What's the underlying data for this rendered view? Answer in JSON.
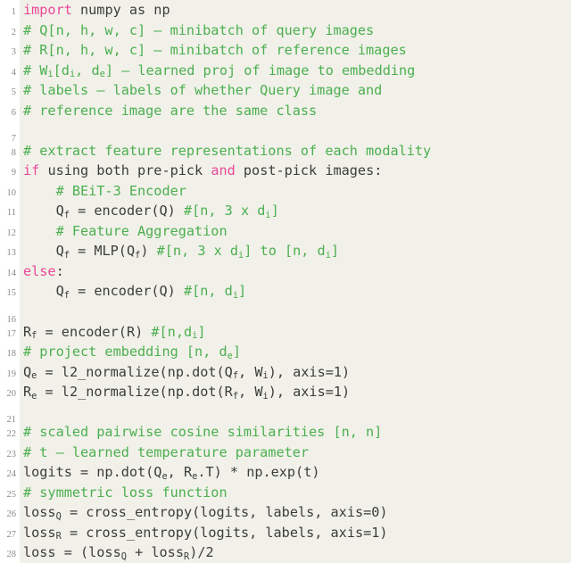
{
  "listing": {
    "language": "python",
    "colors": {
      "background": "#ffffff",
      "code_background": "#f1f1e9",
      "gutter_text": "#8a8a86",
      "keyword": "#ec4899",
      "comment": "#4caf50",
      "text": "#3c3c3c"
    },
    "line_count": 28,
    "lines": [
      {
        "n": "1",
        "tokens": [
          {
            "t": "kw",
            "s": "import"
          },
          {
            "t": "tx",
            "s": " numpy as np"
          }
        ]
      },
      {
        "n": "2",
        "tokens": [
          {
            "t": "cm",
            "s": "# Q[n, h, w, c] – minibatch of query images"
          }
        ]
      },
      {
        "n": "3",
        "tokens": [
          {
            "t": "cm",
            "s": "# R[n, h, w, c] – minibatch of reference images"
          }
        ]
      },
      {
        "n": "4",
        "tokens": [
          {
            "t": "cm",
            "s": "# W"
          },
          {
            "t": "cm-sub",
            "s": "i"
          },
          {
            "t": "cm",
            "s": "[d"
          },
          {
            "t": "cm-sub",
            "s": "i"
          },
          {
            "t": "cm",
            "s": ", d"
          },
          {
            "t": "cm-sub",
            "s": "e"
          },
          {
            "t": "cm",
            "s": "] – learned proj of image to embedding"
          }
        ]
      },
      {
        "n": "5",
        "tokens": [
          {
            "t": "cm",
            "s": "# labels – labels of whether Query image and"
          }
        ]
      },
      {
        "n": "6",
        "tokens": [
          {
            "t": "cm",
            "s": "# reference image are the same class"
          }
        ]
      },
      {
        "n": "7",
        "tokens": []
      },
      {
        "n": "8",
        "tokens": [
          {
            "t": "cm",
            "s": "# extract feature representations of each modality"
          }
        ]
      },
      {
        "n": "9",
        "tokens": [
          {
            "t": "kw",
            "s": "if"
          },
          {
            "t": "tx",
            "s": " using both pre-pick "
          },
          {
            "t": "kw",
            "s": "and"
          },
          {
            "t": "tx",
            "s": " post-pick images:"
          }
        ]
      },
      {
        "n": "10",
        "tokens": [
          {
            "t": "cm",
            "s": "    # BEiT-3 Encoder"
          }
        ]
      },
      {
        "n": "11",
        "tokens": [
          {
            "t": "tx",
            "s": "    Q"
          },
          {
            "t": "tx-sub",
            "s": "f"
          },
          {
            "t": "tx",
            "s": " = encoder(Q) "
          },
          {
            "t": "cm",
            "s": "#[n, 3 x d"
          },
          {
            "t": "cm-sub",
            "s": "i"
          },
          {
            "t": "cm",
            "s": "]"
          }
        ]
      },
      {
        "n": "12",
        "tokens": [
          {
            "t": "cm",
            "s": "    # Feature Aggregation"
          }
        ]
      },
      {
        "n": "13",
        "tokens": [
          {
            "t": "tx",
            "s": "    Q"
          },
          {
            "t": "tx-sub",
            "s": "f"
          },
          {
            "t": "tx",
            "s": " = MLP(Q"
          },
          {
            "t": "tx-sub",
            "s": "f"
          },
          {
            "t": "tx",
            "s": ") "
          },
          {
            "t": "cm",
            "s": "#[n, 3 x d"
          },
          {
            "t": "cm-sub",
            "s": "i"
          },
          {
            "t": "cm",
            "s": "] to [n, d"
          },
          {
            "t": "cm-sub",
            "s": "i"
          },
          {
            "t": "cm",
            "s": "]"
          }
        ]
      },
      {
        "n": "14",
        "tokens": [
          {
            "t": "kw",
            "s": "else"
          },
          {
            "t": "tx",
            "s": ":"
          }
        ]
      },
      {
        "n": "15",
        "tokens": [
          {
            "t": "tx",
            "s": "    Q"
          },
          {
            "t": "tx-sub",
            "s": "f"
          },
          {
            "t": "tx",
            "s": " = encoder(Q) "
          },
          {
            "t": "cm",
            "s": "#[n, d"
          },
          {
            "t": "cm-sub",
            "s": "i"
          },
          {
            "t": "cm",
            "s": "]"
          }
        ]
      },
      {
        "n": "16",
        "tokens": []
      },
      {
        "n": "17",
        "tokens": [
          {
            "t": "tx",
            "s": "R"
          },
          {
            "t": "tx-sub",
            "s": "f"
          },
          {
            "t": "tx",
            "s": " = encoder(R) "
          },
          {
            "t": "cm",
            "s": "#[n,d"
          },
          {
            "t": "cm-sub",
            "s": "i"
          },
          {
            "t": "cm",
            "s": "]"
          }
        ]
      },
      {
        "n": "18",
        "tokens": [
          {
            "t": "cm",
            "s": "# project embedding [n, d"
          },
          {
            "t": "cm-sub",
            "s": "e"
          },
          {
            "t": "cm",
            "s": "]"
          }
        ]
      },
      {
        "n": "19",
        "tokens": [
          {
            "t": "tx",
            "s": "Q"
          },
          {
            "t": "tx-sub",
            "s": "e"
          },
          {
            "t": "tx",
            "s": " = l2_normalize(np.dot(Q"
          },
          {
            "t": "tx-sub",
            "s": "f"
          },
          {
            "t": "tx",
            "s": ", W"
          },
          {
            "t": "tx-sub",
            "s": "i"
          },
          {
            "t": "tx",
            "s": "), axis=1)"
          }
        ]
      },
      {
        "n": "20",
        "tokens": [
          {
            "t": "tx",
            "s": "R"
          },
          {
            "t": "tx-sub",
            "s": "e"
          },
          {
            "t": "tx",
            "s": " = l2_normalize(np.dot(R"
          },
          {
            "t": "tx-sub",
            "s": "f"
          },
          {
            "t": "tx",
            "s": ", W"
          },
          {
            "t": "tx-sub",
            "s": "i"
          },
          {
            "t": "tx",
            "s": "), axis=1)"
          }
        ]
      },
      {
        "n": "21",
        "tokens": []
      },
      {
        "n": "22",
        "tokens": [
          {
            "t": "cm",
            "s": "# scaled pairwise cosine similarities [n, n]"
          }
        ]
      },
      {
        "n": "23",
        "tokens": [
          {
            "t": "cm",
            "s": "# t – learned temperature parameter"
          }
        ]
      },
      {
        "n": "24",
        "tokens": [
          {
            "t": "tx",
            "s": "logits = np.dot(Q"
          },
          {
            "t": "tx-sub",
            "s": "e"
          },
          {
            "t": "tx",
            "s": ", R"
          },
          {
            "t": "tx-sub",
            "s": "e"
          },
          {
            "t": "tx",
            "s": ".T) * np.exp(t)"
          }
        ]
      },
      {
        "n": "25",
        "tokens": [
          {
            "t": "cm",
            "s": "# symmetric loss function"
          }
        ]
      },
      {
        "n": "26",
        "tokens": [
          {
            "t": "tx",
            "s": "loss"
          },
          {
            "t": "tx-sub",
            "s": "Q"
          },
          {
            "t": "tx",
            "s": " = cross_entropy(logits, labels, axis=0)"
          }
        ]
      },
      {
        "n": "27",
        "tokens": [
          {
            "t": "tx",
            "s": "loss"
          },
          {
            "t": "tx-sub",
            "s": "R"
          },
          {
            "t": "tx",
            "s": " = cross_entropy(logits, labels, axis=1)"
          }
        ]
      },
      {
        "n": "28",
        "tokens": [
          {
            "t": "tx",
            "s": "loss = (loss"
          },
          {
            "t": "tx-sub",
            "s": "Q"
          },
          {
            "t": "tx",
            "s": " + loss"
          },
          {
            "t": "tx-sub",
            "s": "R"
          },
          {
            "t": "tx",
            "s": ")/2"
          }
        ]
      }
    ]
  }
}
